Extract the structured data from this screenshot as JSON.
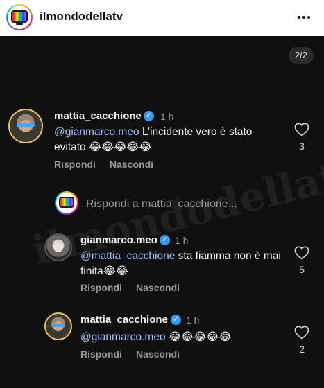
{
  "header": {
    "title": "ilmondodellatv",
    "more_icon": "more-horizontal-icon"
  },
  "page_indicator": "2/2",
  "comments": [
    {
      "username": "mattia_cacchione",
      "time": "1 h",
      "mention": "@gianmarco.meo",
      "text": " L’incidente vero è stato evitato 😂😂😂😂😂",
      "reply_label": "Rispondi",
      "hide_label": "Nascondi",
      "likes": "3"
    }
  ],
  "reply_input": {
    "placeholder": "Rispondi a mattia_cacchione..."
  },
  "replies": [
    {
      "username": "gianmarco.meo",
      "time": "1 h",
      "mention": "@mattia_cacchione",
      "text": " sta fiamma non è mai finita😂😂",
      "reply_label": "Rispondi",
      "hide_label": "Nascondi",
      "likes": "5"
    },
    {
      "username": "mattia_cacchione",
      "time": "1 h",
      "mention": "@gianmarco.meo",
      "text": " 😂😂😂😂😂",
      "reply_label": "Rispondi",
      "hide_label": "Nascondi",
      "likes": "2"
    }
  ],
  "watermark": "ilmondodellatv",
  "colors": {
    "background": "#101010",
    "mention": "#a9c3ff",
    "verified": "#3897f0",
    "muted": "#9a9a9a"
  }
}
